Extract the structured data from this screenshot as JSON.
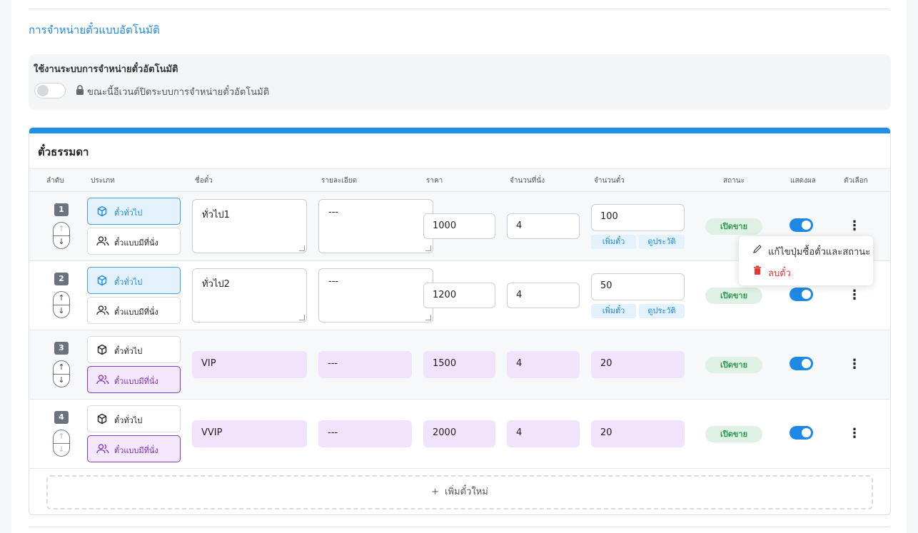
{
  "section": {
    "title": "การจำหน่ายตั๋วแบบอัตโนมัติ"
  },
  "auto_sale": {
    "label": "ใช้งานระบบการจำหน่ายตั๋วอัตโนมัติ",
    "enabled": false,
    "note": "ขณะนี้อีเวนต์ปิดระบบการจำหน่ายตั๋วอัตโนมัติ"
  },
  "panel": {
    "title": "ตั๋วธรรมดา"
  },
  "headers": [
    "ลำดับ",
    "ประเภท",
    "ชื่อตั๋ว",
    "รายละเอียด",
    "ราคา",
    "จำนวนที่นั่ง",
    "จำนวนตั๋ว",
    "สถานะ",
    "แสดงผล",
    "ตัวเลือก"
  ],
  "type_labels": {
    "general": "ตั๋วทั่วไป",
    "seated": "ตั๋วแบบมีที่นั่ง"
  },
  "tickets": [
    {
      "order": "1",
      "type": "general",
      "name": "ทั่วไป1",
      "detail": "---",
      "price": "1000",
      "seats": "4",
      "quantity": "100",
      "status": "เปิดขาย",
      "visible": true,
      "editable": true
    },
    {
      "order": "2",
      "type": "general",
      "name": "ทั่วไป2",
      "detail": "---",
      "price": "1200",
      "seats": "4",
      "quantity": "50",
      "status": "เปิดขาย",
      "visible": true,
      "editable": true
    },
    {
      "order": "3",
      "type": "seated",
      "name": "VIP",
      "detail": "---",
      "price": "1500",
      "seats": "4",
      "quantity": "20",
      "status": "เปิดขาย",
      "visible": true,
      "editable": false
    },
    {
      "order": "4",
      "type": "seated",
      "name": "VVIP",
      "detail": "---",
      "price": "2000",
      "seats": "4",
      "quantity": "20",
      "status": "เปิดขาย",
      "visible": true,
      "editable": false
    }
  ],
  "qty_buttons": {
    "add": "เพิ่มตั๋ว",
    "history": "ดูประวัติ"
  },
  "add_new_label": "เพิ่มตั๋วใหม่",
  "context_menu": {
    "edit": "แก้ไขปุ่มซื้อตั๋วและสถานะ",
    "delete": "ลบตั๋ว"
  },
  "colors": {
    "accent": "#1e88e5",
    "danger": "#e53935",
    "purple": "#7b2fc0",
    "status_green": "#2e9a50"
  }
}
